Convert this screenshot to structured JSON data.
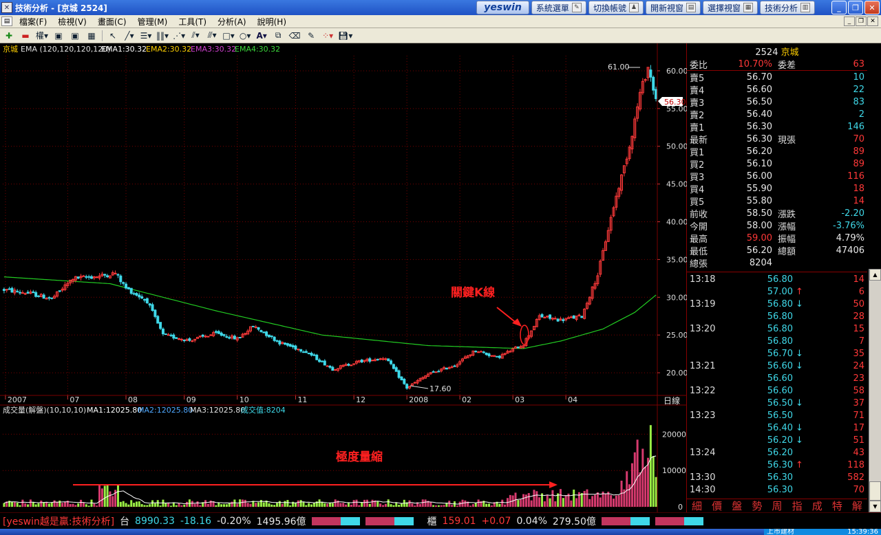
{
  "window": {
    "title": "技術分析 - [京城 2524]",
    "brand_logo": "yeswin",
    "brand_buttons": [
      "系統選單",
      "切換帳號",
      "開新視窗",
      "選擇視窗",
      "技術分析"
    ]
  },
  "menu": [
    "檔案(F)",
    "檢視(V)",
    "畫面(C)",
    "管理(M)",
    "工具(T)",
    "分析(A)",
    "說明(H)"
  ],
  "toolbar": {
    "weight_label": "權"
  },
  "colors": {
    "up": "#ff3a3a",
    "down": "#3fd8e8",
    "ema": "#22cc22",
    "grid": "#7a0000",
    "axis_text": "#dddddd",
    "volume_up": "#d63a6e",
    "volume_down": "#9aee44",
    "bg": "#000000",
    "accent": "#ffd000"
  },
  "price_chart": {
    "stock_label": "京城",
    "indicator": "EMA (120,120,120,120)",
    "ema1": "EMA1:30.32",
    "ema2": "EMA2:30.32",
    "ema3": "EMA3:30.32",
    "ema4": "EMA4:30.32",
    "current_price_tag": "56.30",
    "high_label": "61.00",
    "low_label": "17.60",
    "annotation_key_candle": "關鍵K線",
    "period_label": "日線"
  },
  "volume_chart": {
    "title": "成交量(解盤)(10,10,10)",
    "ma1": "MA1:12025.80",
    "ma2": "MA2:12025.80",
    "ma3": "MA3:12025.80",
    "vol_value": "成交值:8204",
    "annotation": "極度量縮"
  },
  "chart_data": [
    {
      "type": "candlestick",
      "title": "京城 EMA (120,120,120,120)",
      "x_labels": [
        "2007",
        "07",
        "08",
        "09",
        "10",
        "11",
        "12",
        "2008",
        "02",
        "03",
        "04"
      ],
      "y_ticks": [
        20,
        25,
        30,
        35,
        40,
        45,
        50,
        55,
        60
      ],
      "ylim": [
        17,
        62
      ],
      "grid": true,
      "highest": 61.0,
      "lowest": 17.6,
      "last": 56.3,
      "close_path": [
        {
          "bar": 0,
          "value": 31.0
        },
        {
          "bar": 10,
          "value": 30.5
        },
        {
          "bar": 18,
          "value": 29.8
        },
        {
          "bar": 26,
          "value": 32.5
        },
        {
          "bar": 36,
          "value": 32.8
        },
        {
          "bar": 42,
          "value": 33.2
        },
        {
          "bar": 46,
          "value": 31.2
        },
        {
          "bar": 54,
          "value": 29.5
        },
        {
          "bar": 60,
          "value": 25.0
        },
        {
          "bar": 70,
          "value": 24.3
        },
        {
          "bar": 80,
          "value": 25.2
        },
        {
          "bar": 88,
          "value": 24.5
        },
        {
          "bar": 94,
          "value": 26.2
        },
        {
          "bar": 104,
          "value": 24.0
        },
        {
          "bar": 114,
          "value": 22.8
        },
        {
          "bar": 124,
          "value": 20.5
        },
        {
          "bar": 134,
          "value": 21.5
        },
        {
          "bar": 144,
          "value": 22.0
        },
        {
          "bar": 152,
          "value": 18.0
        },
        {
          "bar": 160,
          "value": 19.8
        },
        {
          "bar": 170,
          "value": 21.0
        },
        {
          "bar": 178,
          "value": 23.0
        },
        {
          "bar": 186,
          "value": 22.0
        },
        {
          "bar": 196,
          "value": 23.8
        },
        {
          "bar": 202,
          "value": 27.5
        },
        {
          "bar": 210,
          "value": 27.0
        },
        {
          "bar": 218,
          "value": 27.5
        },
        {
          "bar": 224,
          "value": 33.0
        },
        {
          "bar": 230,
          "value": 42.0
        },
        {
          "bar": 236,
          "value": 50.0
        },
        {
          "bar": 240,
          "value": 57.0
        },
        {
          "bar": 243,
          "value": 60.5
        },
        {
          "bar": 246,
          "value": 56.3
        }
      ],
      "ema_path": [
        {
          "bar": 0,
          "value": 32.7
        },
        {
          "bar": 40,
          "value": 31.8
        },
        {
          "bar": 80,
          "value": 28.2
        },
        {
          "bar": 120,
          "value": 25.0
        },
        {
          "bar": 160,
          "value": 23.6
        },
        {
          "bar": 196,
          "value": 23.2
        },
        {
          "bar": 210,
          "value": 24.2
        },
        {
          "bar": 226,
          "value": 25.8
        },
        {
          "bar": 238,
          "value": 28.0
        },
        {
          "bar": 246,
          "value": 30.3
        }
      ],
      "total_bars": 247
    },
    {
      "type": "bar",
      "title": "成交量(解盤)(10,10,10)",
      "y_ticks": [
        0,
        10000,
        20000
      ],
      "ylim": [
        0,
        25000
      ],
      "recent_volumes": [
        3200,
        7200,
        4800,
        9800,
        6200,
        12000,
        15000,
        18500,
        9500,
        16000,
        11000,
        13500,
        22500,
        14000,
        8204
      ]
    }
  ],
  "quote": {
    "header": {
      "code": "2524",
      "name": "京城"
    },
    "ratio": {
      "label": "委比",
      "value": "10.70%",
      "label2": "委差",
      "value2": "63"
    },
    "asks": [
      {
        "label": "賣5",
        "price": "56.70",
        "vol": "10"
      },
      {
        "label": "賣4",
        "price": "56.60",
        "vol": "22"
      },
      {
        "label": "賣3",
        "price": "56.50",
        "vol": "83"
      },
      {
        "label": "賣2",
        "price": "56.40",
        "vol": "2"
      },
      {
        "label": "賣1",
        "price": "56.30",
        "vol": "146"
      }
    ],
    "latest": {
      "label": "最新",
      "price": "56.30",
      "label2": "現張",
      "vol": "70"
    },
    "bids": [
      {
        "label": "買1",
        "price": "56.20",
        "vol": "89"
      },
      {
        "label": "買2",
        "price": "56.10",
        "vol": "89"
      },
      {
        "label": "買3",
        "price": "56.00",
        "vol": "116"
      },
      {
        "label": "買4",
        "price": "55.90",
        "vol": "18"
      },
      {
        "label": "買5",
        "price": "55.80",
        "vol": "14"
      }
    ],
    "stats": [
      {
        "l1": "前收",
        "v1": "58.50",
        "l2": "漲跌",
        "v2": "-2.20"
      },
      {
        "l1": "今開",
        "v1": "58.00",
        "l2": "漲幅",
        "v2": "-3.76%"
      },
      {
        "l1": "最高",
        "v1": "59.00",
        "l2": "振幅",
        "v2": "4.79%"
      },
      {
        "l1": "最低",
        "v1": "56.20",
        "l2": "總額",
        "v2": "47406"
      },
      {
        "l1": "總張",
        "v1": "8204",
        "l2": "",
        "v2": ""
      }
    ],
    "ticks": [
      {
        "t": "13:18",
        "p": "56.80",
        "a": "",
        "v": "14"
      },
      {
        "t": "",
        "p": "57.00",
        "a": "↑",
        "v": "6"
      },
      {
        "t": "13:19",
        "p": "56.80",
        "a": "↓",
        "v": "50"
      },
      {
        "t": "",
        "p": "56.80",
        "a": "",
        "v": "28"
      },
      {
        "t": "13:20",
        "p": "56.80",
        "a": "",
        "v": "15"
      },
      {
        "t": "",
        "p": "56.80",
        "a": "",
        "v": "7"
      },
      {
        "t": "",
        "p": "56.70",
        "a": "↓",
        "v": "35"
      },
      {
        "t": "13:21",
        "p": "56.60",
        "a": "↓",
        "v": "24"
      },
      {
        "t": "",
        "p": "56.60",
        "a": "",
        "v": "23"
      },
      {
        "t": "13:22",
        "p": "56.60",
        "a": "",
        "v": "58"
      },
      {
        "t": "",
        "p": "56.50",
        "a": "↓",
        "v": "37"
      },
      {
        "t": "13:23",
        "p": "56.50",
        "a": "",
        "v": "71"
      },
      {
        "t": "",
        "p": "56.40",
        "a": "↓",
        "v": "17"
      },
      {
        "t": "",
        "p": "56.20",
        "a": "↓",
        "v": "51"
      },
      {
        "t": "13:24",
        "p": "56.20",
        "a": "",
        "v": "43"
      },
      {
        "t": "",
        "p": "56.30",
        "a": "↑",
        "v": "118"
      },
      {
        "t": "13:30",
        "p": "56.30",
        "a": "",
        "v": "582"
      },
      {
        "t": "14:30",
        "p": "56.30",
        "a": "",
        "v": "70"
      }
    ],
    "bottom_tabs": [
      "細",
      "價",
      "盤",
      "勢",
      "周",
      "指",
      "成",
      "特",
      "解"
    ]
  },
  "statusbar": {
    "brand": "[yeswin越是贏:技術分析]",
    "taiex_label": "台",
    "taiex_index": "8990.33",
    "taiex_change": "-18.16",
    "taiex_pct": "-0.20%",
    "taiex_amount": "1495.96億",
    "otc_label": "櫃",
    "otc_index": "159.01",
    "otc_change": "+0.07",
    "otc_pct": "0.04%",
    "otc_amount": "279.50億",
    "sector": "上市建材",
    "clock": "15:39:36"
  }
}
